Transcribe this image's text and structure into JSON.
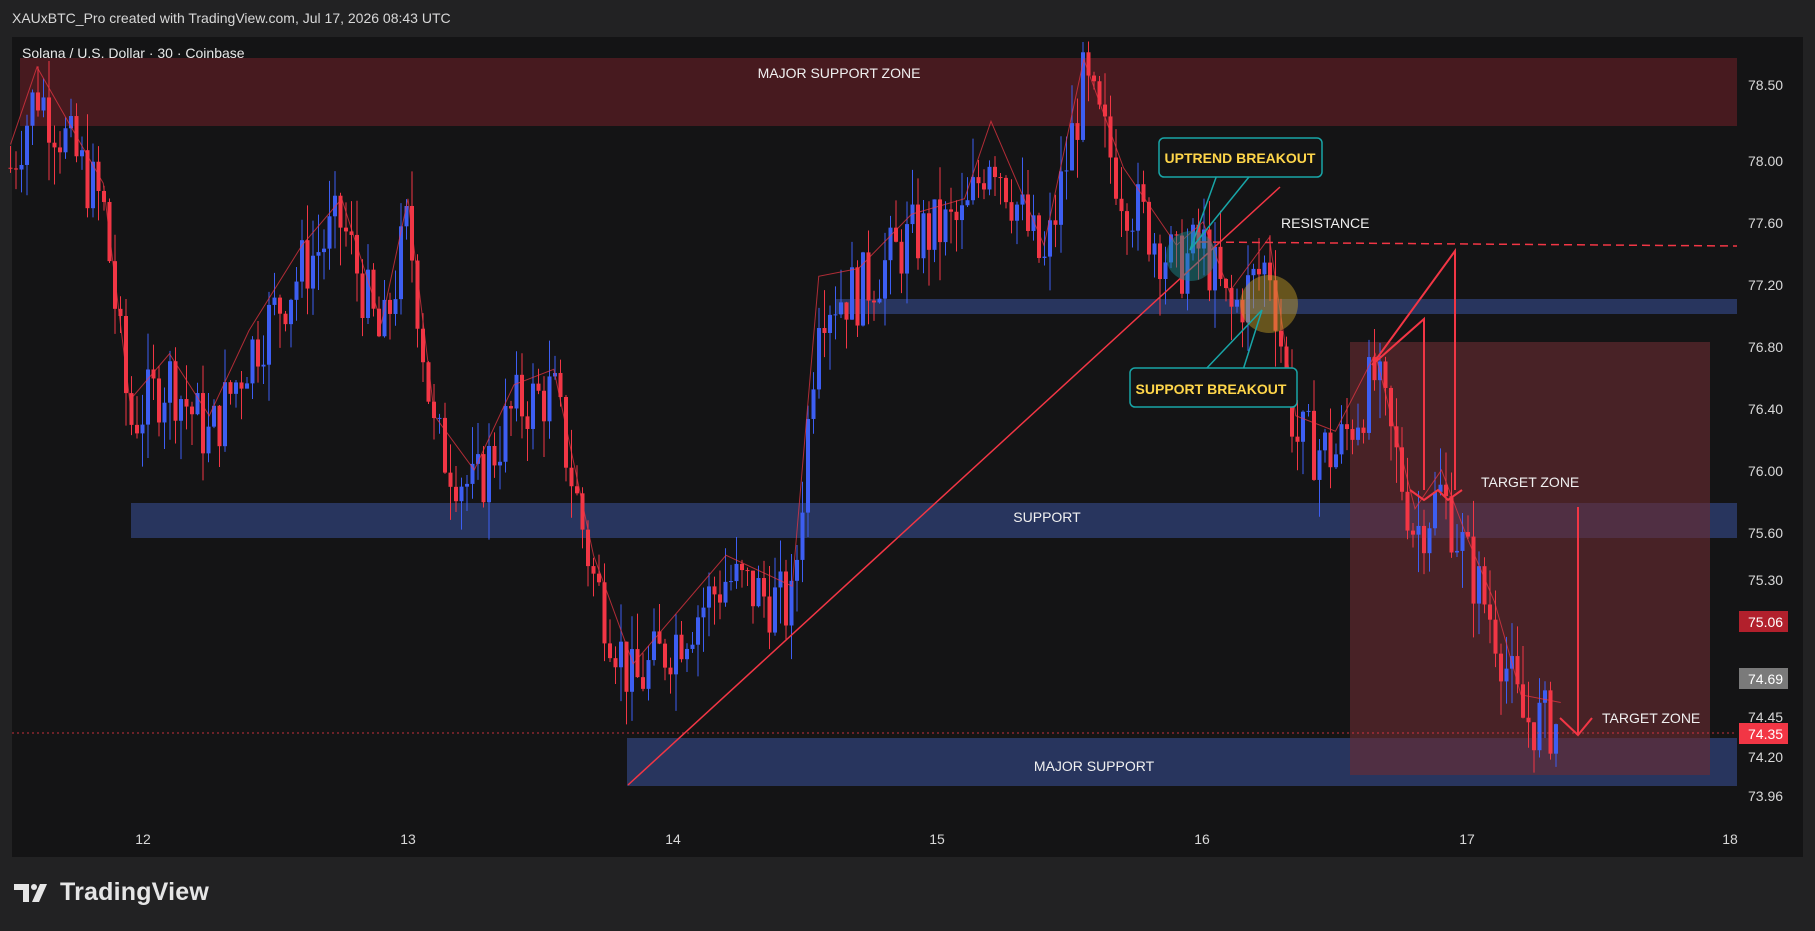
{
  "header": {
    "caption": "XAUxBTC_Pro created with TradingView.com, Jul 17, 2026 08:43 UTC",
    "symbol_title": "Solana / U.S. Dollar · 30 · Coinbase"
  },
  "brand": {
    "logo_text": "TradingView",
    "logo_icon": "tradingview-logo-icon"
  },
  "colors": {
    "background": "#222223",
    "chart_bg": "#141415",
    "candle_up": "#3d5ef2",
    "candle_down": "#f23645",
    "resistance_zone": "#4a1a20",
    "support_zone": "#28355e",
    "target_box": "#5a2a2e",
    "callout_border": "#18a5a7",
    "callout_text": "#ffd64a"
  },
  "zones": {
    "major_support_zone": "MAJOR SUPPORT ZONE",
    "support": "SUPPORT",
    "major_support": "MAJOR SUPPORT"
  },
  "annotations": {
    "uptrend_breakout": "UPTREND BREAKOUT",
    "support_breakout": "SUPPORT BREAKOUT",
    "resistance": "RESISTANCE",
    "target_zone_1": "TARGET ZONE",
    "target_zone_2": "TARGET ZONE"
  },
  "price_axis": {
    "ticks": [
      "78.50",
      "78.00",
      "77.60",
      "77.20",
      "76.80",
      "76.40",
      "76.00",
      "75.60",
      "75.30",
      "74.45",
      "74.20",
      "73.96"
    ]
  },
  "price_tags": [
    {
      "label": "75.06",
      "color": "#b2202c"
    },
    {
      "label": "74.69",
      "color": "#7a7a7a"
    },
    {
      "label": "74.35",
      "color": "#f23645"
    }
  ],
  "time_axis": {
    "labels": [
      "12",
      "13",
      "14",
      "15",
      "16",
      "17",
      "18"
    ]
  },
  "chart_data": {
    "type": "candlestick",
    "title": "Solana / U.S. Dollar · 30 · Coinbase",
    "x_labels": [
      "12",
      "13",
      "14",
      "15",
      "16",
      "17",
      "18"
    ],
    "y_ticks": [
      78.5,
      78.0,
      77.6,
      77.2,
      76.8,
      76.4,
      76.0,
      75.6,
      75.3,
      74.45,
      74.2,
      73.96
    ],
    "ylim": [
      73.96,
      78.6
    ],
    "last_price": 74.35,
    "levels": {
      "major_support_zone": [
        78.2,
        78.65
      ],
      "support": [
        75.6,
        75.8
      ],
      "major_support": [
        73.96,
        74.3
      ],
      "resistance_line": 77.45,
      "broken_support_zone": [
        77.05,
        77.15
      ]
    },
    "price_path": [
      {
        "x": 11.5,
        "y": 77.95
      },
      {
        "x": 11.6,
        "y": 78.45
      },
      {
        "x": 11.75,
        "y": 78.0
      },
      {
        "x": 11.85,
        "y": 77.7
      },
      {
        "x": 11.95,
        "y": 76.3
      },
      {
        "x": 12.1,
        "y": 76.6
      },
      {
        "x": 12.25,
        "y": 76.2
      },
      {
        "x": 12.4,
        "y": 76.75
      },
      {
        "x": 12.6,
        "y": 77.3
      },
      {
        "x": 12.75,
        "y": 77.6
      },
      {
        "x": 12.9,
        "y": 76.8
      },
      {
        "x": 13.0,
        "y": 77.6
      },
      {
        "x": 13.1,
        "y": 76.2
      },
      {
        "x": 13.25,
        "y": 75.85
      },
      {
        "x": 13.4,
        "y": 76.4
      },
      {
        "x": 13.55,
        "y": 76.5
      },
      {
        "x": 13.7,
        "y": 75.3
      },
      {
        "x": 13.85,
        "y": 74.6
      },
      {
        "x": 14.0,
        "y": 74.9
      },
      {
        "x": 14.2,
        "y": 75.3
      },
      {
        "x": 14.45,
        "y": 75.1
      },
      {
        "x": 14.55,
        "y": 77.1
      },
      {
        "x": 14.7,
        "y": 77.15
      },
      {
        "x": 14.9,
        "y": 77.5
      },
      {
        "x": 15.1,
        "y": 77.6
      },
      {
        "x": 15.2,
        "y": 78.1
      },
      {
        "x": 15.4,
        "y": 77.3
      },
      {
        "x": 15.55,
        "y": 78.5
      },
      {
        "x": 15.7,
        "y": 77.8
      },
      {
        "x": 15.9,
        "y": 77.3
      },
      {
        "x": 16.0,
        "y": 77.45
      },
      {
        "x": 16.1,
        "y": 77.0
      },
      {
        "x": 16.25,
        "y": 77.35
      },
      {
        "x": 16.35,
        "y": 76.2
      },
      {
        "x": 16.5,
        "y": 76.1
      },
      {
        "x": 16.65,
        "y": 76.6
      },
      {
        "x": 16.8,
        "y": 75.6
      },
      {
        "x": 16.9,
        "y": 75.85
      },
      {
        "x": 17.0,
        "y": 75.4
      },
      {
        "x": 17.1,
        "y": 75.0
      },
      {
        "x": 17.2,
        "y": 74.4
      },
      {
        "x": 17.35,
        "y": 74.35
      }
    ]
  }
}
